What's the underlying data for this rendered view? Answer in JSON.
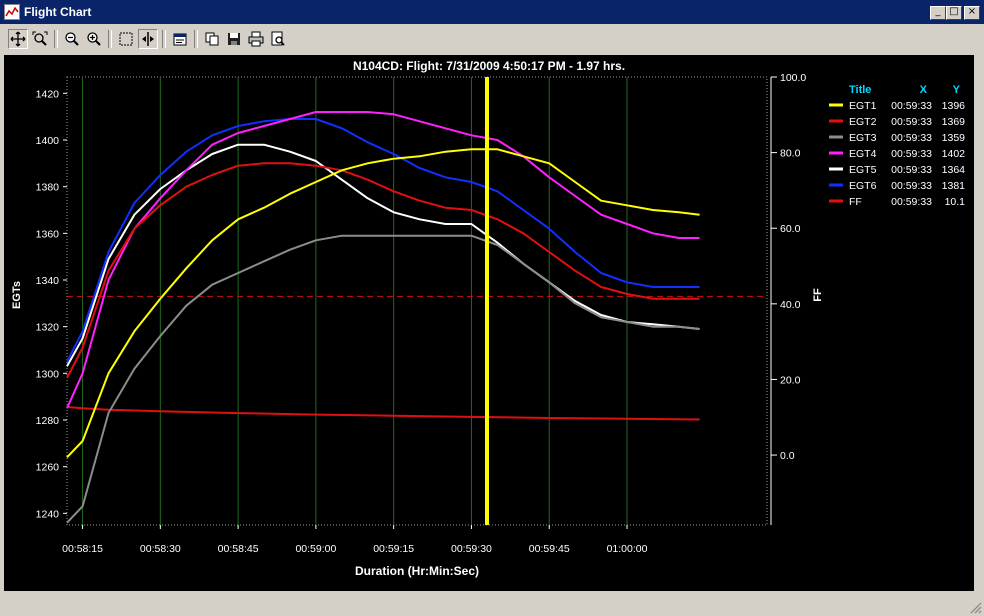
{
  "window": {
    "title": "Flight Chart",
    "minimize_glyph": "_",
    "maximize_glyph": "□",
    "close_glyph": "×"
  },
  "toolbar": {
    "icons": [
      "pan-icon",
      "zoom-box-icon",
      "zoom-out-icon",
      "zoom-in-icon",
      "select-box-icon",
      "cursor-icon",
      "properties-icon",
      "copy-icon",
      "save-icon",
      "print-icon",
      "print-preview-icon"
    ]
  },
  "colors": {
    "background": "#000000",
    "grid": "#1f6b1f",
    "cursor": "#ffff00",
    "axis_text": "#ffffff",
    "legend_header": "#00d8ff"
  },
  "legend": {
    "header": {
      "title": "Title",
      "x": "X",
      "y": "Y"
    }
  },
  "chart_data": {
    "type": "line",
    "title": "N104CD:  Flight: 7/31/2009 4:50:17 PM - 1.97 hrs.",
    "xlabel": "Duration (Hr:Min:Sec)",
    "ylabel": "EGTs",
    "y2label": "FF",
    "x_range": [
      "00:58:12",
      "01:00:27"
    ],
    "xticks": [
      "00:58:15",
      "00:58:30",
      "00:58:45",
      "00:59:00",
      "00:59:15",
      "00:59:30",
      "00:59:45",
      "01:00:00"
    ],
    "ylim": [
      1235,
      1427
    ],
    "yticks": [
      1240,
      1260,
      1280,
      1300,
      1320,
      1340,
      1360,
      1380,
      1400,
      1420
    ],
    "y2lim": [
      -18.5,
      100.0
    ],
    "y2ticks": [
      "0.0",
      "20.0",
      "40.0",
      "60.0",
      "80.0",
      "100.0"
    ],
    "y2tick_values": [
      0,
      20,
      40,
      60,
      80,
      100
    ],
    "grid": "vertical",
    "cursor_x": "00:59:33",
    "reference_line_y": 1333,
    "legend_position": "right",
    "series": [
      {
        "name": "EGT1",
        "color": "#ffff00",
        "axis": "left",
        "cursor_x": "00:59:33",
        "cursor_y": "1396",
        "x": [
          "00:58:12",
          "00:58:15",
          "00:58:20",
          "00:58:25",
          "00:58:30",
          "00:58:35",
          "00:58:40",
          "00:58:45",
          "00:58:50",
          "00:58:55",
          "00:59:00",
          "00:59:05",
          "00:59:10",
          "00:59:15",
          "00:59:20",
          "00:59:25",
          "00:59:30",
          "00:59:35",
          "00:59:40",
          "00:59:45",
          "00:59:50",
          "00:59:55",
          "01:00:00",
          "01:00:05",
          "01:00:10",
          "01:00:14"
        ],
        "y": [
          1264,
          1271,
          1300,
          1318,
          1332,
          1345,
          1357,
          1366,
          1371,
          1377,
          1382,
          1387,
          1390,
          1392,
          1393,
          1395,
          1396,
          1396,
          1393,
          1390,
          1382,
          1374,
          1372,
          1370,
          1369,
          1368
        ]
      },
      {
        "name": "EGT2",
        "color": "#e01010",
        "axis": "left",
        "cursor_x": "00:59:33",
        "cursor_y": "1369",
        "x": [
          "00:58:12",
          "00:58:15",
          "00:58:20",
          "00:58:25",
          "00:58:30",
          "00:58:35",
          "00:58:40",
          "00:58:45",
          "00:58:50",
          "00:58:55",
          "00:59:00",
          "00:59:05",
          "00:59:10",
          "00:59:15",
          "00:59:20",
          "00:59:25",
          "00:59:30",
          "00:59:35",
          "00:59:40",
          "00:59:45",
          "00:59:50",
          "00:59:55",
          "01:00:00",
          "01:00:05",
          "01:00:10",
          "01:00:14"
        ],
        "y": [
          1298,
          1311,
          1344,
          1362,
          1372,
          1380,
          1385,
          1389,
          1390,
          1390,
          1389,
          1387,
          1383,
          1378,
          1374,
          1371,
          1370,
          1366,
          1360,
          1352,
          1344,
          1337,
          1334,
          1332,
          1332,
          1332
        ]
      },
      {
        "name": "EGT3",
        "color": "#8c8c8c",
        "axis": "left",
        "cursor_x": "00:59:33",
        "cursor_y": "1359",
        "x": [
          "00:58:12",
          "00:58:15",
          "00:58:20",
          "00:58:25",
          "00:58:30",
          "00:58:35",
          "00:58:40",
          "00:58:45",
          "00:58:50",
          "00:58:55",
          "00:59:00",
          "00:59:05",
          "00:59:10",
          "00:59:15",
          "00:59:20",
          "00:59:25",
          "00:59:30",
          "00:59:35",
          "00:59:40",
          "00:59:45",
          "00:59:50",
          "00:59:55",
          "01:00:00",
          "01:00:05",
          "01:00:10",
          "01:00:14"
        ],
        "y": [
          1236,
          1243,
          1283,
          1302,
          1316,
          1329,
          1338,
          1343,
          1348,
          1353,
          1357,
          1359,
          1359,
          1359,
          1359,
          1359,
          1359,
          1355,
          1347,
          1339,
          1330,
          1324,
          1322,
          1320,
          1320,
          1319
        ]
      },
      {
        "name": "EGT4",
        "color": "#ff20ff",
        "axis": "left",
        "cursor_x": "00:59:33",
        "cursor_y": "1402",
        "x": [
          "00:58:12",
          "00:58:15",
          "00:58:20",
          "00:58:25",
          "00:58:30",
          "00:58:35",
          "00:58:40",
          "00:58:45",
          "00:58:50",
          "00:58:55",
          "00:59:00",
          "00:59:05",
          "00:59:10",
          "00:59:15",
          "00:59:20",
          "00:59:25",
          "00:59:30",
          "00:59:35",
          "00:59:40",
          "00:59:45",
          "00:59:50",
          "00:59:55",
          "01:00:00",
          "01:00:05",
          "01:00:10",
          "01:00:14"
        ],
        "y": [
          1285,
          1300,
          1340,
          1362,
          1375,
          1387,
          1398,
          1403,
          1406,
          1409,
          1412,
          1412,
          1412,
          1411,
          1408,
          1405,
          1402,
          1400,
          1393,
          1384,
          1376,
          1368,
          1364,
          1360,
          1358,
          1358
        ]
      },
      {
        "name": "EGT5",
        "color": "#ffffff",
        "axis": "left",
        "cursor_x": "00:59:33",
        "cursor_y": "1364",
        "x": [
          "00:58:12",
          "00:58:15",
          "00:58:20",
          "00:58:25",
          "00:58:30",
          "00:58:35",
          "00:58:40",
          "00:58:45",
          "00:58:50",
          "00:58:55",
          "00:59:00",
          "00:59:05",
          "00:59:10",
          "00:59:15",
          "00:59:20",
          "00:59:25",
          "00:59:30",
          "00:59:35",
          "00:59:40",
          "00:59:45",
          "00:59:50",
          "00:59:55",
          "01:00:00",
          "01:00:05",
          "01:00:10",
          "01:00:14"
        ],
        "y": [
          1303,
          1315,
          1349,
          1368,
          1379,
          1387,
          1394,
          1398,
          1398,
          1395,
          1391,
          1383,
          1375,
          1369,
          1366,
          1364,
          1364,
          1356,
          1347,
          1339,
          1331,
          1325,
          1322,
          1321,
          1320,
          1319
        ]
      },
      {
        "name": "EGT6",
        "color": "#1030ff",
        "axis": "left",
        "cursor_x": "00:59:33",
        "cursor_y": "1381",
        "x": [
          "00:58:12",
          "00:58:15",
          "00:58:20",
          "00:58:25",
          "00:58:30",
          "00:58:35",
          "00:58:40",
          "00:58:45",
          "00:58:50",
          "00:58:55",
          "00:59:00",
          "00:59:05",
          "00:59:10",
          "00:59:15",
          "00:59:20",
          "00:59:25",
          "00:59:30",
          "00:59:35",
          "00:59:40",
          "00:59:45",
          "00:59:50",
          "00:59:55",
          "01:00:00",
          "01:00:05",
          "01:00:10",
          "01:00:14"
        ],
        "y": [
          1305,
          1318,
          1352,
          1373,
          1385,
          1395,
          1402,
          1406,
          1408,
          1409,
          1409,
          1405,
          1399,
          1394,
          1388,
          1384,
          1382,
          1378,
          1370,
          1362,
          1352,
          1343,
          1339,
          1337,
          1337,
          1337
        ]
      },
      {
        "name": "FF",
        "color": "#e01010",
        "axis": "right",
        "cursor_x": "00:59:33",
        "cursor_y": "10.1",
        "x": [
          "00:58:12",
          "00:58:15",
          "00:58:20",
          "00:58:30",
          "00:58:45",
          "00:59:00",
          "00:59:15",
          "00:59:30",
          "00:59:45",
          "01:00:00",
          "01:00:14"
        ],
        "y": [
          12.7,
          12.4,
          12.0,
          11.6,
          11.1,
          10.7,
          10.4,
          10.1,
          9.8,
          9.6,
          9.4
        ]
      }
    ]
  }
}
